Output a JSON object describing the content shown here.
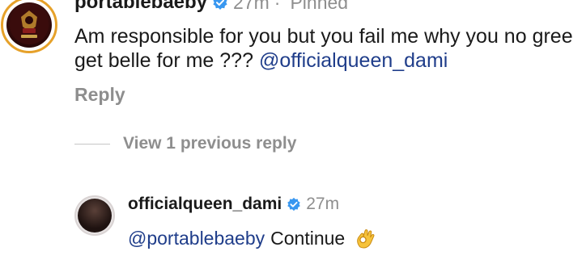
{
  "comment": {
    "username": "portablebaeby",
    "time": "27m",
    "separator": "·",
    "pinned_label": "Pinned",
    "text": "Am responsible for you but you fail me why you no gree get belle for me ???",
    "mention": "@officialqueen_dami",
    "reply_label": "Reply",
    "avatar_icon": "logo-avatar-icon",
    "verified_icon": "verified-badge-icon"
  },
  "view_previous": {
    "label": "View 1 previous reply"
  },
  "reply": {
    "username": "officialqueen_dami",
    "time": "27m",
    "mention": "@portablebaeby",
    "text": "Continue",
    "emoji": "ok-hand-emoji",
    "verified_icon": "verified-badge-icon"
  },
  "colors": {
    "verified_blue": "#3897f0",
    "mention_blue": "#1f3d8a",
    "muted_gray": "#8e8e8e",
    "avatar_ring": "#e6a12a"
  }
}
